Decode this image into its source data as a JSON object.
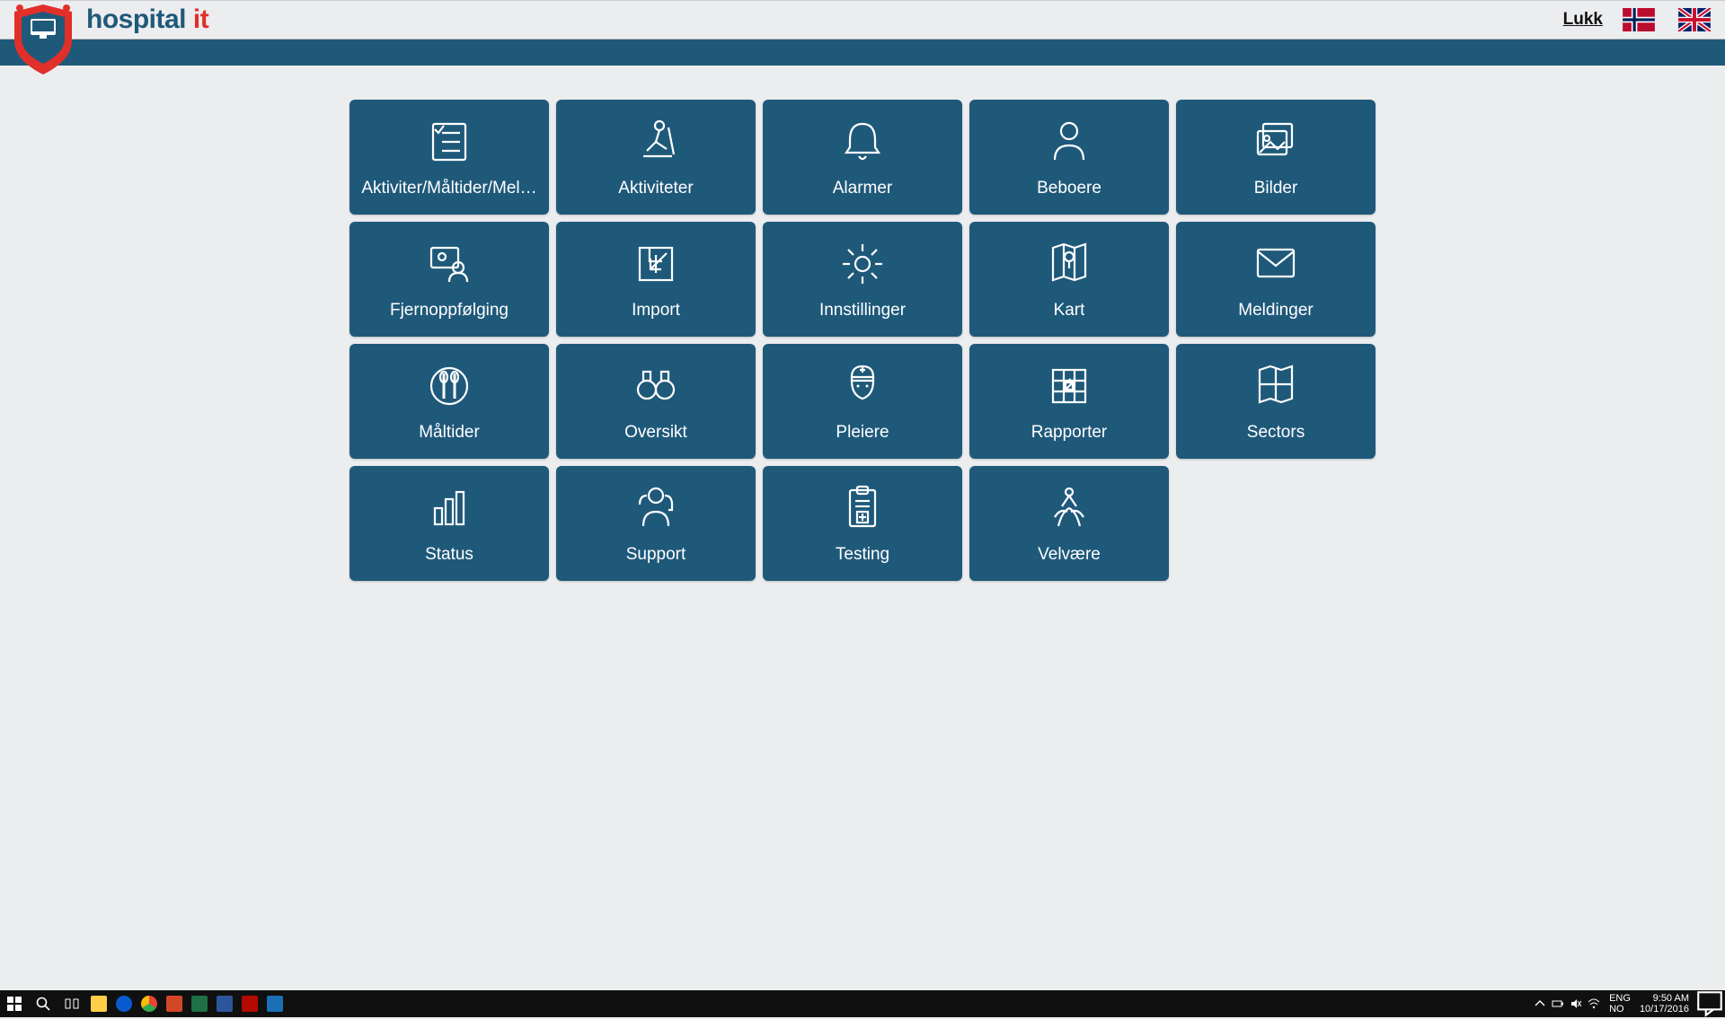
{
  "header": {
    "brand_word1": "hospital",
    "brand_word2": "it",
    "close_label": "Lukk"
  },
  "tiles": [
    {
      "label": "Aktiviter/Måltider/Mel…",
      "icon": "checklist"
    },
    {
      "label": "Aktiviteter",
      "icon": "skier"
    },
    {
      "label": "Alarmer",
      "icon": "bell"
    },
    {
      "label": "Beboere",
      "icon": "person"
    },
    {
      "label": "Bilder",
      "icon": "images"
    },
    {
      "label": "Fjernoppfølging",
      "icon": "videoperson"
    },
    {
      "label": "Import",
      "icon": "import"
    },
    {
      "label": "Innstillinger",
      "icon": "gear"
    },
    {
      "label": "Kart",
      "icon": "mappin"
    },
    {
      "label": "Meldinger",
      "icon": "envelope"
    },
    {
      "label": "Måltider",
      "icon": "plate"
    },
    {
      "label": "Oversikt",
      "icon": "binoculars"
    },
    {
      "label": "Pleiere",
      "icon": "nurse"
    },
    {
      "label": "Rapporter",
      "icon": "reportgrid"
    },
    {
      "label": "Sectors",
      "icon": "sectors"
    },
    {
      "label": "Status",
      "icon": "bars"
    },
    {
      "label": "Support",
      "icon": "headset"
    },
    {
      "label": "Testing",
      "icon": "clipboardplus"
    },
    {
      "label": "Velvære",
      "icon": "wellbeing"
    }
  ],
  "taskbar": {
    "lang_top": "ENG",
    "lang_bottom": "NO",
    "time": "9:50 AM",
    "date": "10/17/2016"
  }
}
